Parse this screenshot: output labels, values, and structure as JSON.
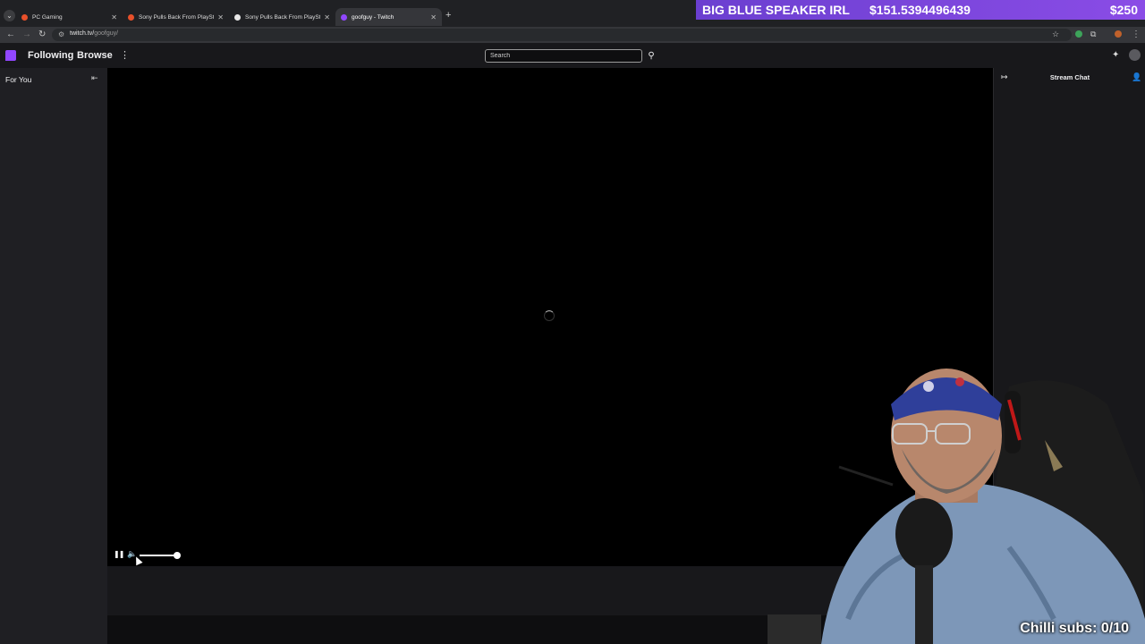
{
  "browser": {
    "tabs": [
      {
        "title": "PC Gaming",
        "favicon_color": "#e8502a",
        "active": false
      },
      {
        "title": "Sony Pulls Back From PlayStatio",
        "favicon_color": "#e8502a",
        "active": false
      },
      {
        "title": "Sony Pulls Back From PlayStatio",
        "favicon_color": "#e8e8e8",
        "active": false
      },
      {
        "title": "goofguy - Twitch",
        "favicon_color": "#9147ff",
        "active": true
      }
    ],
    "url_domain": "twitch.tv/",
    "url_path": "goofguy/"
  },
  "twitch_nav": {
    "following": "Following",
    "browse": "Browse",
    "search_placeholder": "Search",
    "accent": "#9147ff"
  },
  "sidebar": {
    "for_you": "For You"
  },
  "player": {
    "volume_level": 0.95,
    "state": "loading"
  },
  "chat": {
    "title": "Stream Chat"
  },
  "overlay": {
    "donation_title": "BIG BLUE SPEAKER IRL",
    "donation_amount": "$151.5394496439",
    "donation_goal": "$250",
    "subs_text": "Chilli subs: 0/10"
  },
  "icons": [
    "tab-search-icon",
    "close-icon",
    "plus-icon",
    "back-icon",
    "forward-icon",
    "reload-icon",
    "site-info-icon",
    "star-icon",
    "extensions-icon",
    "twitch-logo-icon",
    "more-icon",
    "search-icon",
    "collapse-icon",
    "pause-icon",
    "volume-icon",
    "spinner-icon",
    "users-icon"
  ]
}
